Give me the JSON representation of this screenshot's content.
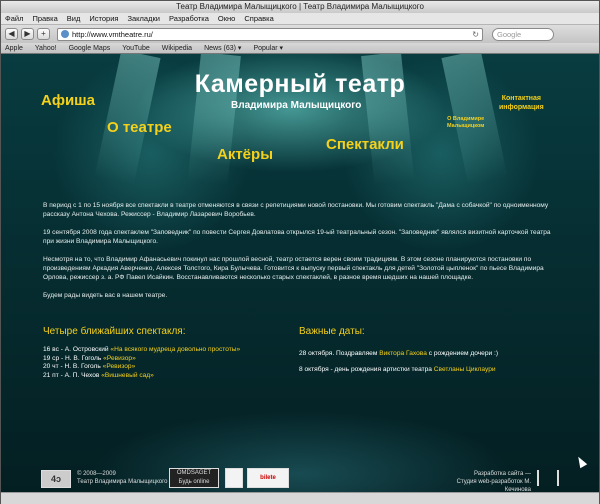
{
  "window": {
    "title": "Театр Владимира Малыщицкого | Театр Владимира Малыщицкого"
  },
  "menu": [
    "Файл",
    "Правка",
    "Вид",
    "История",
    "Закладки",
    "Разработка",
    "Окно",
    "Справка"
  ],
  "toolbar": {
    "back": "◀",
    "forward": "▶",
    "add": "+",
    "url": "http://www.vmtheatre.ru/",
    "search_placeholder": "Google"
  },
  "bookmarks": [
    "Apple",
    "Yahoo!",
    "Google Maps",
    "YouTube",
    "Wikipedia",
    "News (63) ▾",
    "Popular ▾"
  ],
  "header": {
    "title": "Камерный театр",
    "subtitle": "Владимира Малыщицкого"
  },
  "nav": {
    "afisha": "Афиша",
    "about": "О театре",
    "actors": "Актёры",
    "shows": "Спектакли",
    "contacts_1": "Контактная",
    "contacts_2": "информация",
    "about_small_1": "О Владимире",
    "about_small_2": "Малыщицком"
  },
  "paragraphs": [
    "В период с 1 по 15 ноября все спектакли в театре отменяются в связи с репетициями новой постановки. Мы готовим спектакль \"Дама с собачкой\" по одноименному рассказу Антона Чехова. Режиссер - Владимир Лазаревич Воробьев.",
    "19 сентября 2008 года спектаклем \"Заповедник\" по повести Сергея Довлатова открылся 19-ый театральный сезон. \"Заповедник\" являлся визитной карточкой театра при жизни Владимира Малыщицкого.",
    "Несмотря на то, что Владимир Афанасьевич покинул нас прошлой весной, театр остается верен своим традициям. В этом сезоне планируются постановки по произведениям Аркадия Аверченко, Алексея Толстого, Кира Булычева. Готовится к выпуску первый спектакль для детей \"Золотой цыпленок\" по пьесе Владимира Орлова, режиссер з. а. РФ Павел Исайкин. Восстанавливаются несколько старых спектаклей, в разное время шедших на нашей площадке.",
    "Будем рады видеть вас в нашем театре."
  ],
  "upcoming": {
    "title": "Четыре ближайших спектакля:",
    "items": [
      {
        "prefix": "16 вс - А. Островский ",
        "link": "«На всякого мудреца довольно простоты»"
      },
      {
        "prefix": "19 ср - Н. В. Гоголь ",
        "link": "«Ревизор»"
      },
      {
        "prefix": "20 чт - Н. В. Гоголь ",
        "link": "«Ревизор»"
      },
      {
        "prefix": "21 пт - А. П. Чехов ",
        "link": "«Вишневый сад»"
      }
    ]
  },
  "dates": {
    "title": "Важные даты:",
    "items": [
      {
        "prefix": "28 октября. Поздравляем ",
        "link": "Виктора Гахова",
        "suffix": " с рождением дочери :)"
      },
      {
        "prefix": "8 октября - день рождения артистки театра ",
        "link": "Светланы Циклаури",
        "suffix": ""
      }
    ]
  },
  "footer": {
    "copyright_1": "© 2008—2009",
    "copyright_2": "Театр Владимира Малыщицкого",
    "logo_1": "OMDSAGET",
    "logo_1_sub": "Будь online",
    "logo_3": "bilete",
    "dev_1": "Разработка сайта —",
    "dev_2": "Студия web-разработок М. Кечинова"
  }
}
